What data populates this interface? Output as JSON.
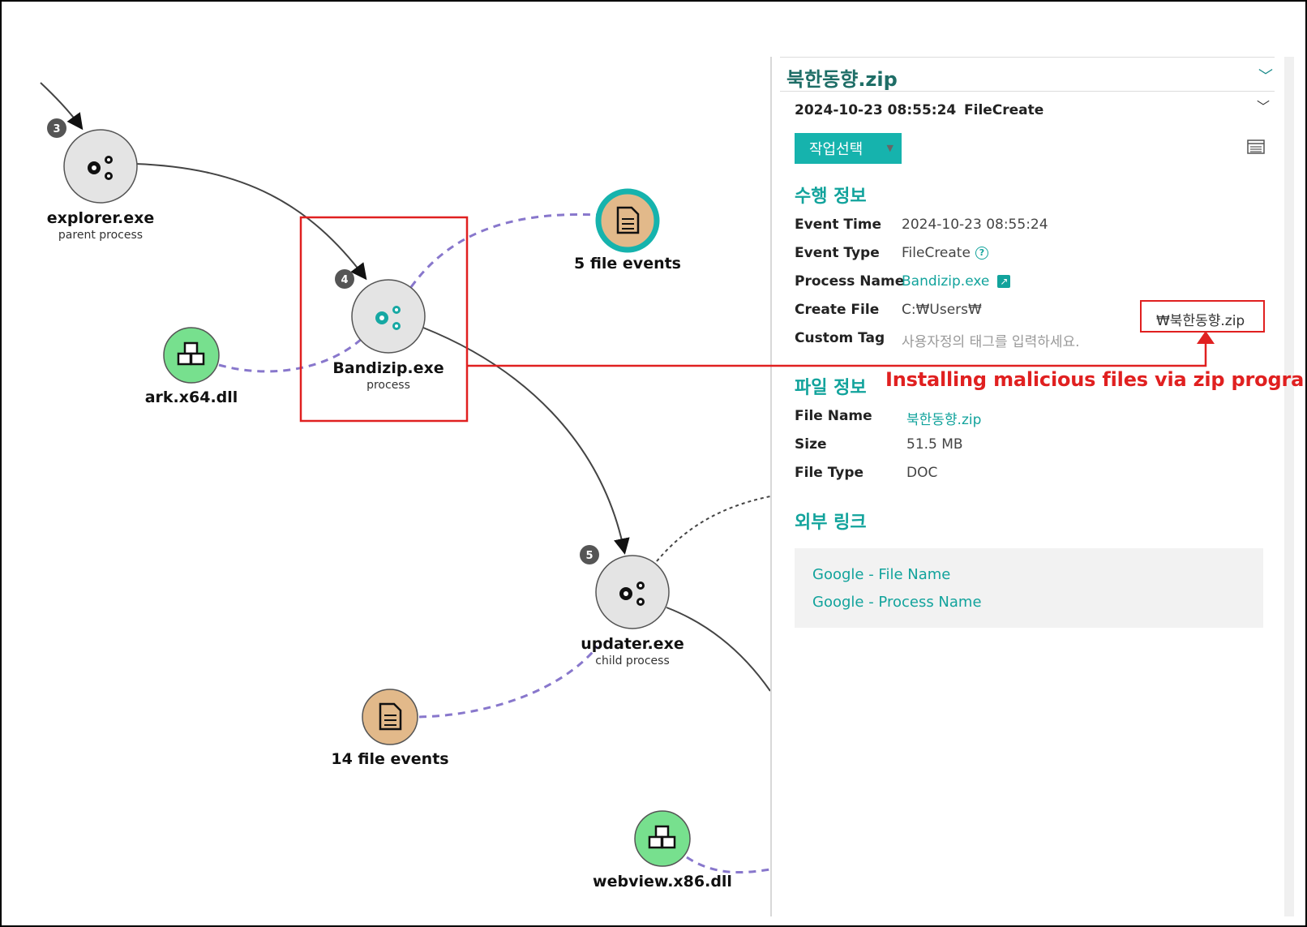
{
  "graph": {
    "nodes": [
      {
        "id": "explorer",
        "label": "explorer.exe",
        "sub": "parent process",
        "type": "process",
        "badge": "3"
      },
      {
        "id": "bandizip",
        "label": "Bandizip.exe",
        "sub": "process",
        "type": "process",
        "badge": "4",
        "highlight": true
      },
      {
        "id": "fileevents5",
        "label": "5 file events",
        "sub": "",
        "type": "file-selected"
      },
      {
        "id": "ark",
        "label": "ark.x64.dll",
        "sub": "",
        "type": "dll"
      },
      {
        "id": "updater",
        "label": "updater.exe",
        "sub": "child process",
        "type": "process",
        "badge": "5"
      },
      {
        "id": "fileevents14",
        "label": "14 file events",
        "sub": "",
        "type": "file"
      },
      {
        "id": "webview",
        "label": "webview.x86.dll",
        "sub": "",
        "type": "dll"
      }
    ],
    "colors": {
      "process_fill": "#e4e4e4",
      "file_fill": "#e2b98a",
      "dll_fill": "#77e08e",
      "teal": "#16b3ad",
      "dashed_edge": "#8877cc",
      "highlight": "#e02020"
    }
  },
  "panel": {
    "title": "북한동향.zip",
    "event_time_head": "2024-10-23 08:55:24",
    "event_type_head": "FileCreate",
    "action_button": "작업선택",
    "section_exec": "수행 정보",
    "exec_rows": {
      "event_time_label": "Event Time",
      "event_time_value": "2024-10-23 08:55:24",
      "event_type_label": "Event Type",
      "event_type_value": "FileCreate",
      "process_name_label": "Process Name",
      "process_name_value": "Bandizip.exe",
      "create_file_label": "Create File",
      "create_file_value": "C:₩Users₩",
      "create_file_suffix": "₩북한동향.zip",
      "custom_tag_label": "Custom Tag",
      "custom_tag_placeholder": "사용자정의 태그를 입력하세요."
    },
    "section_file": "파일 정보",
    "file_rows": {
      "file_name_label": "File Name",
      "file_name_value": "북한동향.zip",
      "size_label": "Size",
      "size_value": "51.5 MB",
      "file_type_label": "File Type",
      "file_type_value": "DOC"
    },
    "section_links": "외부 링크",
    "links": [
      "Google - File Name",
      "Google - Process Name"
    ]
  },
  "annotation": "Installing malicious files via zip program"
}
